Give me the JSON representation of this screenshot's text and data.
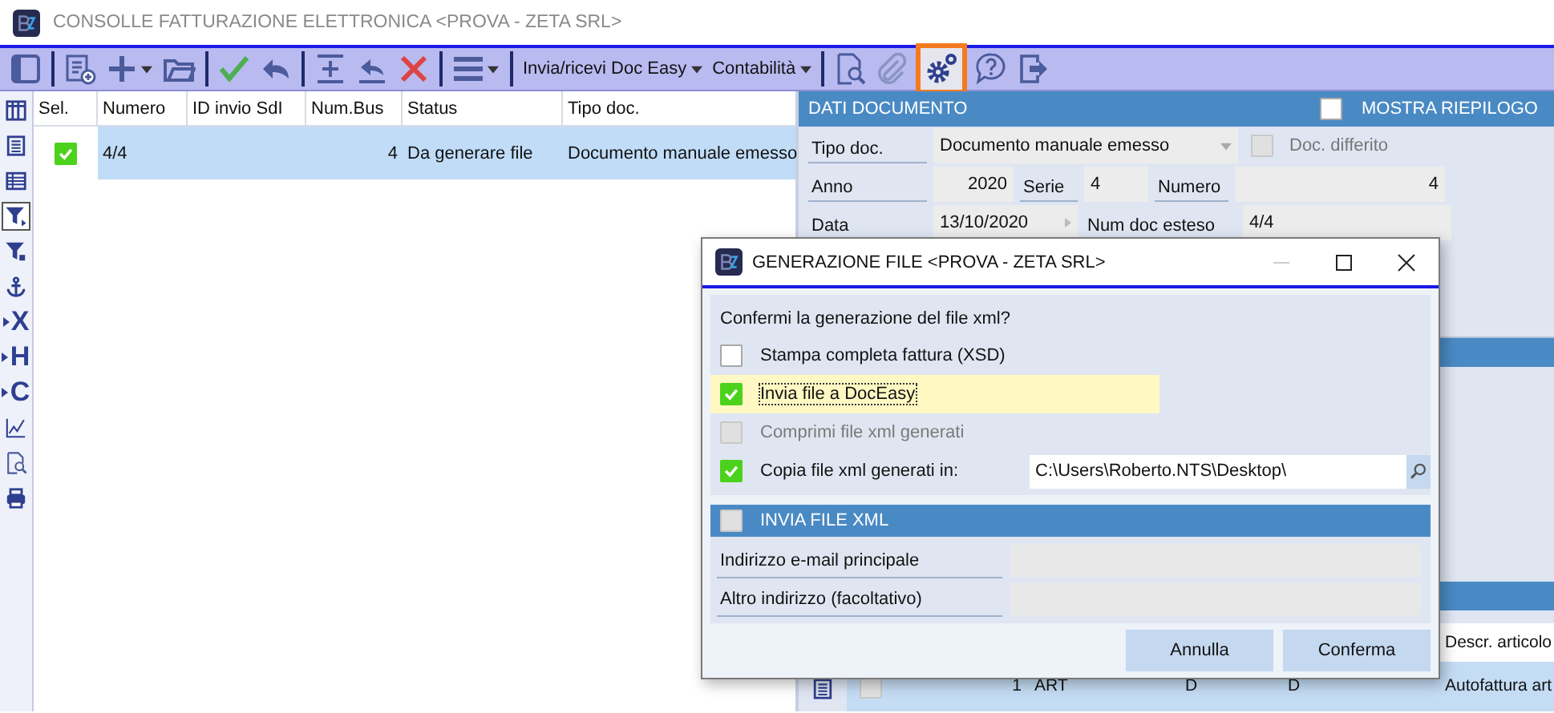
{
  "window": {
    "title": "CONSOLLE FATTURAZIONE ELETTRONICA <PROVA - ZETA SRL>"
  },
  "toolbar": [
    {
      "kind": "panel",
      "highlighted": false
    },
    {
      "kind": "separator"
    },
    {
      "kind": "new-list",
      "highlighted": false
    },
    {
      "kind": "add",
      "dropdown": true,
      "highlighted": false
    },
    {
      "kind": "folder",
      "highlighted": false
    },
    {
      "kind": "separator"
    },
    {
      "kind": "check",
      "highlighted": false
    },
    {
      "kind": "undo",
      "highlighted": false
    },
    {
      "kind": "separator"
    },
    {
      "kind": "insert-row",
      "highlighted": false
    },
    {
      "kind": "undo-row",
      "highlighted": false
    },
    {
      "kind": "delete",
      "highlighted": false
    },
    {
      "kind": "separator"
    },
    {
      "kind": "menu",
      "dropdown": true,
      "highlighted": false
    },
    {
      "kind": "separator"
    },
    {
      "kind": "text",
      "label": "Invia/ricevi Doc Easy",
      "dropdown": true,
      "highlighted": false
    },
    {
      "kind": "text",
      "label": "Contabilità",
      "dropdown": true,
      "highlighted": false
    },
    {
      "kind": "separator"
    },
    {
      "kind": "doc-search",
      "highlighted": false
    },
    {
      "kind": "paperclip",
      "highlighted": false
    },
    {
      "kind": "gears",
      "highlighted": true
    },
    {
      "kind": "help",
      "highlighted": false
    },
    {
      "kind": "exit",
      "highlighted": false
    }
  ],
  "side_tools": [
    {
      "kind": "columns",
      "selected": false
    },
    {
      "kind": "list",
      "selected": false
    },
    {
      "kind": "grid",
      "selected": false
    },
    {
      "kind": "filter",
      "selected": true
    },
    {
      "kind": "filter-small",
      "selected": false
    },
    {
      "kind": "anchor",
      "selected": false
    },
    {
      "kind": "letter",
      "label": "X",
      "selected": false
    },
    {
      "kind": "letter",
      "label": "H",
      "selected": false
    },
    {
      "kind": "letter",
      "label": "C",
      "selected": false
    },
    {
      "kind": "chart",
      "selected": false
    },
    {
      "kind": "doc-search",
      "selected": false
    },
    {
      "kind": "printer",
      "selected": false
    }
  ],
  "grid": {
    "columns": [
      "Sel.",
      "Numero",
      "ID invio SdI",
      "Num.Bus",
      "Status",
      "Tipo doc."
    ],
    "rows": [
      {
        "selected": true,
        "checked": true,
        "cells": [
          null,
          "4/4",
          "",
          "4",
          "Da generare file",
          "Documento manuale emesso"
        ]
      }
    ]
  },
  "document_panel": {
    "title": "DATI DOCUMENTO",
    "show_summary": {
      "label": "MOSTRA RIEPILOGO",
      "checked": false
    },
    "tipo_doc": {
      "label": "Tipo doc.",
      "value": "Documento manuale emesso"
    },
    "doc_differito": {
      "label": "Doc. differito",
      "checked": false,
      "disabled": true
    },
    "anno": {
      "label": "Anno",
      "value": "2020"
    },
    "serie": {
      "label": "Serie",
      "value": "4"
    },
    "numero": {
      "label": "Numero",
      "value": "4"
    },
    "data": {
      "label": "Data",
      "value": "13/10/2020"
    },
    "num_doc_esteso": {
      "label": "Num doc esteso",
      "value": "4/4"
    }
  },
  "rows_panel": {
    "columns": [
      null,
      null,
      null,
      null,
      "Descr. articolo"
    ],
    "rows": [
      {
        "checked": false,
        "cells": [
          "1",
          "ART",
          "D",
          "D",
          "Autofattura art"
        ]
      }
    ]
  },
  "dialog": {
    "title": "GENERAZIONE FILE <PROVA - ZETA SRL>",
    "question": "Confermi la generazione del file xml?",
    "options": [
      {
        "kind": "checkbox",
        "label": "Stampa completa fattura (XSD)",
        "checked": false,
        "disabled": false,
        "focused": false
      },
      {
        "kind": "checkbox",
        "label": "Invia file a DocEasy",
        "checked": true,
        "disabled": false,
        "focused": true
      },
      {
        "kind": "checkbox",
        "label": "Comprimi file xml generati",
        "checked": false,
        "disabled": true,
        "focused": false
      },
      {
        "kind": "path",
        "label": "Copia file xml generati in:",
        "checked": true,
        "disabled": false,
        "focused": false,
        "value": "C:\\Users\\Roberto.NTS\\Desktop\\"
      }
    ],
    "send_section": {
      "title": "INVIA FILE XML",
      "checked": false,
      "disabled": true,
      "fields": [
        {
          "label": "Indirizzo e-mail principale",
          "disabled": true
        },
        {
          "label": "Altro indirizzo (facoltativo)",
          "disabled": true
        }
      ]
    },
    "buttons": [
      {
        "label": "Annulla"
      },
      {
        "label": "Conferma"
      }
    ]
  }
}
